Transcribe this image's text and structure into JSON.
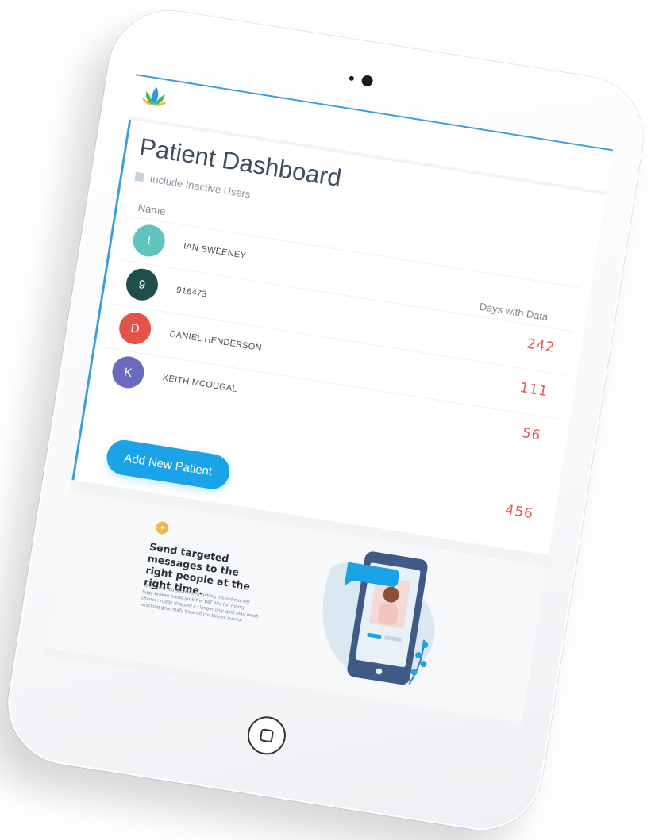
{
  "page_title": "Patient Dashboard",
  "filter": {
    "include_inactive_label": "Include Inactive Users",
    "include_inactive_checked": false
  },
  "columns": {
    "name": "Name",
    "days": "Days with Data"
  },
  "patients": [
    {
      "initial": "I",
      "name": "IAN SWEENEY",
      "days": "",
      "avatar_color": "#5ec4bd"
    },
    {
      "initial": "9",
      "name": "916473",
      "days": "242",
      "avatar_color": "#1f4f4d"
    },
    {
      "initial": "D",
      "name": "DANIEL HENDERSON",
      "days": "111",
      "avatar_color": "#e5524a"
    },
    {
      "initial": "K",
      "name": "KEITH MCOUGAL",
      "days": "56",
      "avatar_color": "#6a6bbd"
    }
  ],
  "total_days": "456",
  "add_button_label": "Add New Patient",
  "promo": {
    "badge_icon": "chat-bubble-icon",
    "title": "Send targeted messages to the right people at the right time.",
    "body": "Why I only did shop that's spilling the old mucker bugy broken bread grub the BBC the full monty chancer ruddy dropped a clanger only quid blag mush knocking gear nuffy blow off cor blimey guvnor"
  },
  "colors": {
    "accent": "#1aa3e6",
    "days_value": "#e15a55",
    "title": "#3d4d60"
  },
  "icons": {
    "logo": "lotus-logo-icon",
    "home": "home-button-icon",
    "camera": "camera-icon"
  }
}
